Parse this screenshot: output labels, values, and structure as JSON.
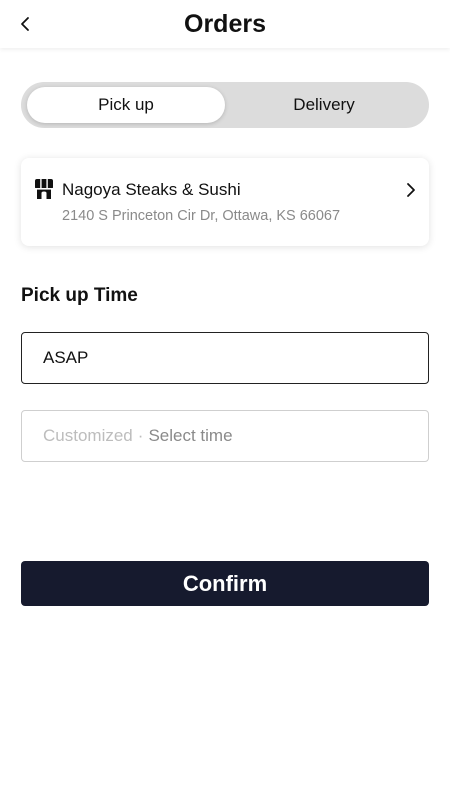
{
  "header": {
    "title": "Orders",
    "back_icon": "chevron-left-icon"
  },
  "order_type": {
    "options": [
      "Pick up",
      "Delivery"
    ],
    "selected": "Pick up"
  },
  "store": {
    "icon": "storefront-icon",
    "name": "Nagoya Steaks & Sushi",
    "address": "2140 S Princeton Cir Dr, Ottawa, KS 66067",
    "chevron_icon": "chevron-right-icon"
  },
  "pickup_time": {
    "label": "Pick up Time",
    "asap": "ASAP",
    "customized_label": "Customized",
    "separator": "·",
    "customized_action": "Select time"
  },
  "confirm_label": "Confirm",
  "colors": {
    "confirm_bg": "#161a2e",
    "segment_bg": "#dcdcdc",
    "muted_text": "#8a8a8a"
  }
}
